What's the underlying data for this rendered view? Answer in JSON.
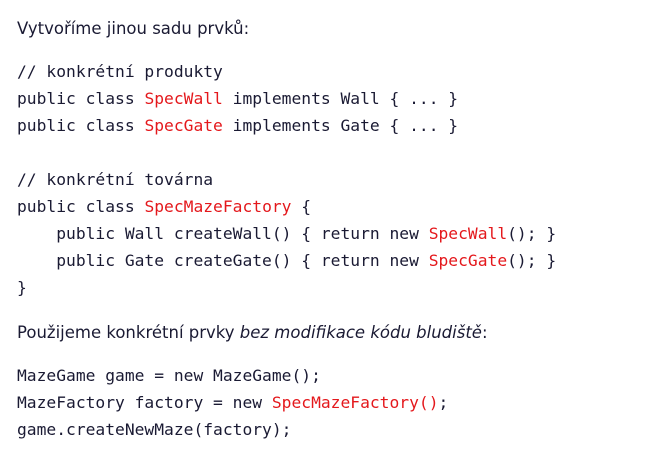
{
  "intro_text": "Vytvoříme jinou sadu prvků:",
  "code_block_1": {
    "lines": [
      [
        {
          "t": "// konkrétní produkty"
        }
      ],
      [
        {
          "t": "public class "
        },
        {
          "t": "SpecWall",
          "hl": true
        },
        {
          "t": " implements Wall { ... }"
        }
      ],
      [
        {
          "t": "public class "
        },
        {
          "t": "SpecGate",
          "hl": true
        },
        {
          "t": " implements Gate { ... }"
        }
      ],
      [
        {
          "t": ""
        }
      ],
      [
        {
          "t": "// konkrétní továrna"
        }
      ],
      [
        {
          "t": "public class "
        },
        {
          "t": "SpecMazeFactory",
          "hl": true
        },
        {
          "t": " {"
        }
      ],
      [
        {
          "t": "    public Wall createWall() { return new "
        },
        {
          "t": "SpecWall",
          "hl": true
        },
        {
          "t": "(); }"
        }
      ],
      [
        {
          "t": "    public Gate createGate() { return new "
        },
        {
          "t": "SpecGate",
          "hl": true
        },
        {
          "t": "(); }"
        }
      ],
      [
        {
          "t": "}"
        }
      ]
    ]
  },
  "usage_text": {
    "prefix": "Použijeme konkrétní prvky ",
    "emphasis": "bez modifikace kódu bludiště",
    "suffix": ":"
  },
  "code_block_2": {
    "lines": [
      [
        {
          "t": "MazeGame game = new MazeGame();"
        }
      ],
      [
        {
          "t": "MazeFactory factory = new "
        },
        {
          "t": "SpecMazeFactory()",
          "hl": true
        },
        {
          "t": ";"
        }
      ],
      [
        {
          "t": "game.createNewMaze(factory);"
        }
      ]
    ]
  },
  "colors": {
    "text": "#1a1a33",
    "highlight": "#e4181c",
    "background": "#ffffff"
  }
}
